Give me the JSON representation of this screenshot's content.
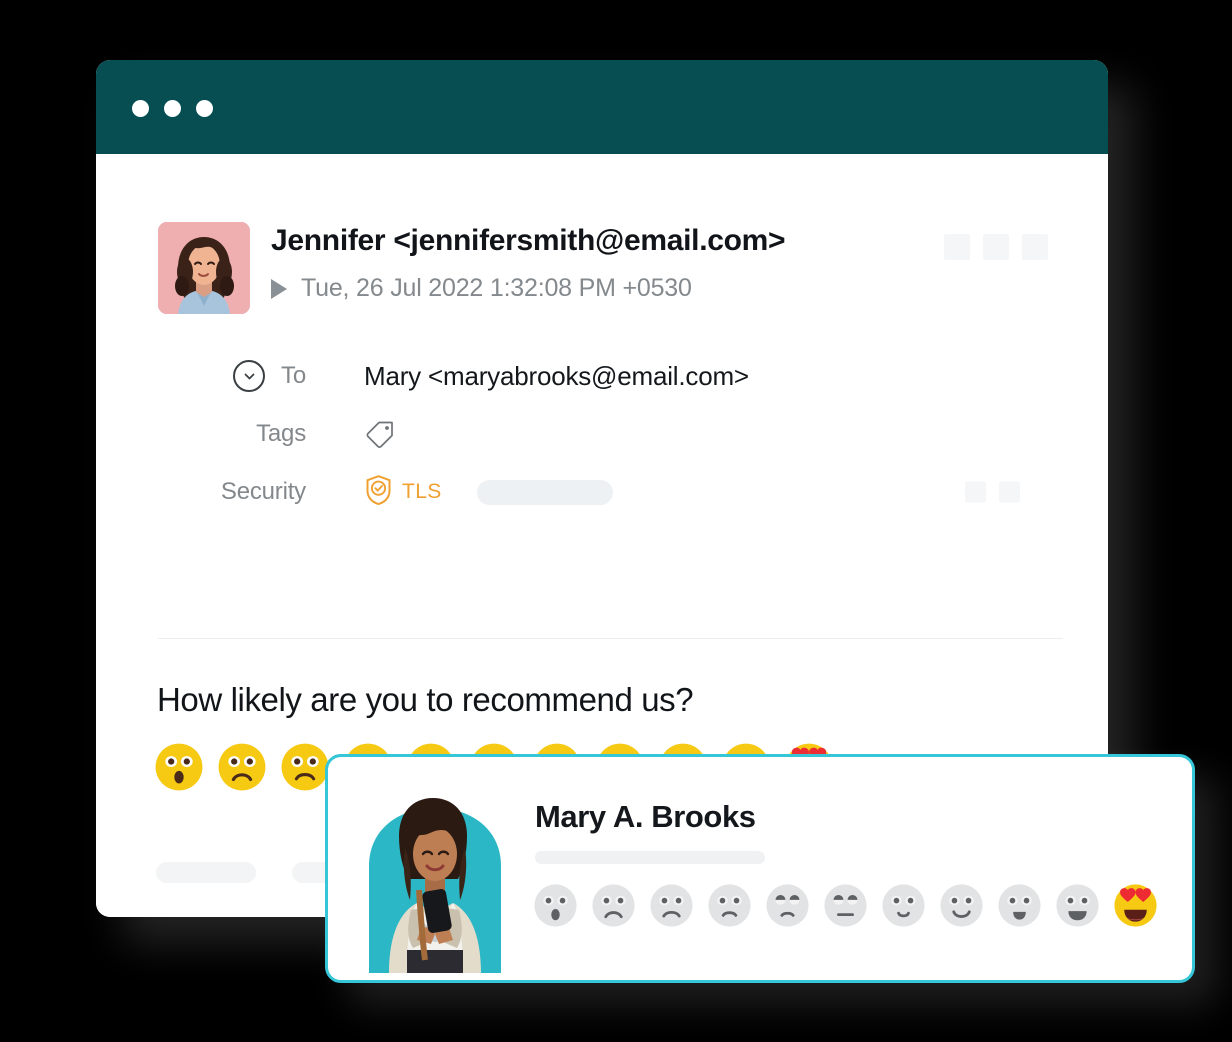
{
  "window": {
    "titlebar": {
      "color": "#064E52",
      "dots": [
        "window-dot-1",
        "window-dot-2",
        "window-dot-3"
      ]
    }
  },
  "email": {
    "avatar_alt": "Jennifer avatar",
    "sender": "Jennifer <jennifersmith@email.com>",
    "date": "Tue, 26 Jul 2022 1:32:08 PM  +0530",
    "expand_icon": "triangle-right-icon",
    "header_placeholders": 3,
    "meta_rows": [
      {
        "icon": "chevron-down-circle-icon",
        "label": "To",
        "value": "Mary <maryabrooks@email.com>"
      },
      {
        "icon": "tag-icon",
        "label": "Tags",
        "value": ""
      },
      {
        "icon": "shield-check-icon",
        "label": "Security",
        "value": "TLS"
      }
    ],
    "security_badge_color": "#F0A030",
    "security_placeholders": 2
  },
  "survey": {
    "question": "How likely are you to recommend us?",
    "scale_count": 11,
    "faces": [
      {
        "name": "face-frowning-open-mouth",
        "score": 0
      },
      {
        "name": "face-sad-1",
        "score": 1
      },
      {
        "name": "face-sad-2",
        "score": 2
      },
      {
        "name": "face-sad-3",
        "score": 3
      },
      {
        "name": "face-slightly-sad",
        "score": 4
      },
      {
        "name": "face-neutral",
        "score": 5
      },
      {
        "name": "face-slightly-smiling",
        "score": 6
      },
      {
        "name": "face-smiling",
        "score": 7
      },
      {
        "name": "face-grinning-small",
        "score": 8
      },
      {
        "name": "face-grinning-wide",
        "score": 9
      },
      {
        "name": "face-heart-eyes",
        "score": 10
      }
    ],
    "emoji_color": "#F6C913",
    "placeholder_pills": 2
  },
  "card": {
    "border_color": "#35C6D7",
    "photo_alt": "Mary A. Brooks photo",
    "photo_bg": "#2BB7C6",
    "name": "Mary A. Brooks",
    "subtitle_placeholder": true,
    "selected_score": 10,
    "faces": [
      {
        "name": "face-frowning-open-mouth",
        "score": 0,
        "selected": false
      },
      {
        "name": "face-sad-1",
        "score": 1,
        "selected": false
      },
      {
        "name": "face-sad-2",
        "score": 2,
        "selected": false
      },
      {
        "name": "face-sad-3",
        "score": 3,
        "selected": false
      },
      {
        "name": "face-slightly-sad",
        "score": 4,
        "selected": false
      },
      {
        "name": "face-neutral",
        "score": 5,
        "selected": false
      },
      {
        "name": "face-slightly-smiling",
        "score": 6,
        "selected": false
      },
      {
        "name": "face-smiling",
        "score": 7,
        "selected": false
      },
      {
        "name": "face-grinning-small",
        "score": 8,
        "selected": false
      },
      {
        "name": "face-grinning-wide",
        "score": 9,
        "selected": false
      },
      {
        "name": "face-heart-eyes",
        "score": 10,
        "selected": true
      }
    ],
    "inactive_color": "#E2E3E4"
  }
}
